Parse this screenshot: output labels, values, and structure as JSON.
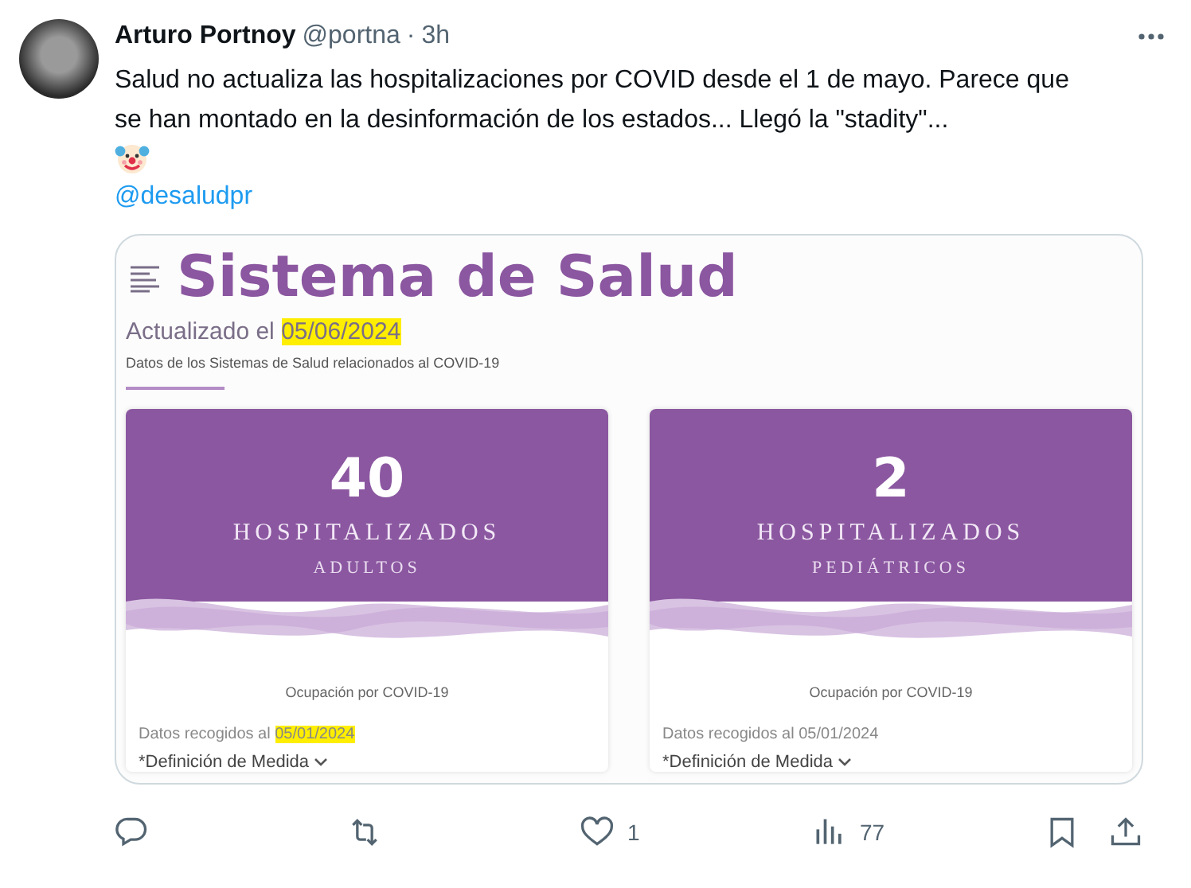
{
  "author": {
    "name": "Arturo Portnoy",
    "handle": "@portna",
    "separator": "·",
    "time": "3h"
  },
  "tweet": {
    "text": "Salud no actualiza las hospitalizaciones por COVID desde el 1 de mayo. Parece que se han montado en la desinformación de los estados... Llegó la \"stadity\"...",
    "mention": "@desaludpr"
  },
  "image": {
    "title": "Sistema de Salud",
    "updated_label": "Actualizado el",
    "updated_date": "05/06/2024",
    "updated_highlighted": true,
    "subtitle": "Datos de los Sistemas de Salud relacionados al COVID-19",
    "cards": [
      {
        "value": "40",
        "label": "HOSPITALIZADOS",
        "sublabel": "ADULTOS",
        "caption": "Ocupación por COVID-19",
        "collected_label": "Datos recogidos al",
        "collected_date": "05/01/2024",
        "highlighted": true,
        "definition": "*Definición de Medida"
      },
      {
        "value": "2",
        "label": "HOSPITALIZADOS",
        "sublabel": "PEDIÁTRICOS",
        "caption": "Ocupación por COVID-19",
        "collected_label": "Datos recogidos al",
        "collected_date": "05/01/2024",
        "highlighted": false,
        "definition": "*Definición de Medida"
      }
    ]
  },
  "actions": [
    {
      "kind": "reply"
    },
    {
      "kind": "repost"
    },
    {
      "kind": "like",
      "count": "1"
    },
    {
      "kind": "views",
      "count": "77"
    }
  ]
}
